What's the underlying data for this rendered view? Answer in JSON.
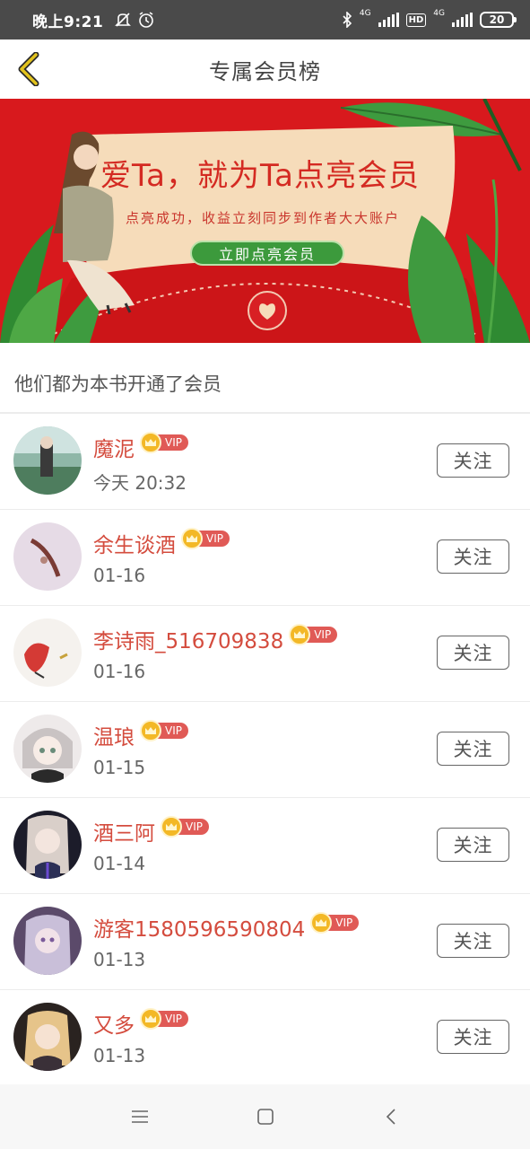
{
  "status_bar": {
    "time": "晚上9:21",
    "net_label_1": "4G",
    "hd_label": "HD",
    "net_label_2": "4G",
    "battery": "20"
  },
  "nav": {
    "title": "专属会员榜"
  },
  "banner": {
    "headline": "爱Ta，就为Ta点亮会员",
    "subtitle": "点亮成功，收益立刻同步到作者大大账户",
    "button_label": "立即点亮会员"
  },
  "section_title": "他们都为本书开通了会员",
  "vip_label": "VIP",
  "follow_label": "关注",
  "members": [
    {
      "name": "魔泥",
      "date": "今天 20:32"
    },
    {
      "name": "余生谈酒",
      "date": "01-16"
    },
    {
      "name": "李诗雨_516709838",
      "date": "01-16"
    },
    {
      "name": "温琅",
      "date": "01-15"
    },
    {
      "name": "酒三阿",
      "date": "01-14"
    },
    {
      "name": "游客1580596590804",
      "date": "01-13"
    },
    {
      "name": "又多",
      "date": "01-13"
    }
  ],
  "colors": {
    "accent_red": "#d44c3e",
    "banner_red": "#d8191d",
    "vip_gold": "#f3b826",
    "back_arrow": "#d7b41c"
  },
  "icons": [
    "back-arrow-icon",
    "crown-icon",
    "menu-icon",
    "home-icon",
    "back-icon",
    "bluetooth-icon",
    "alarm-icon"
  ]
}
